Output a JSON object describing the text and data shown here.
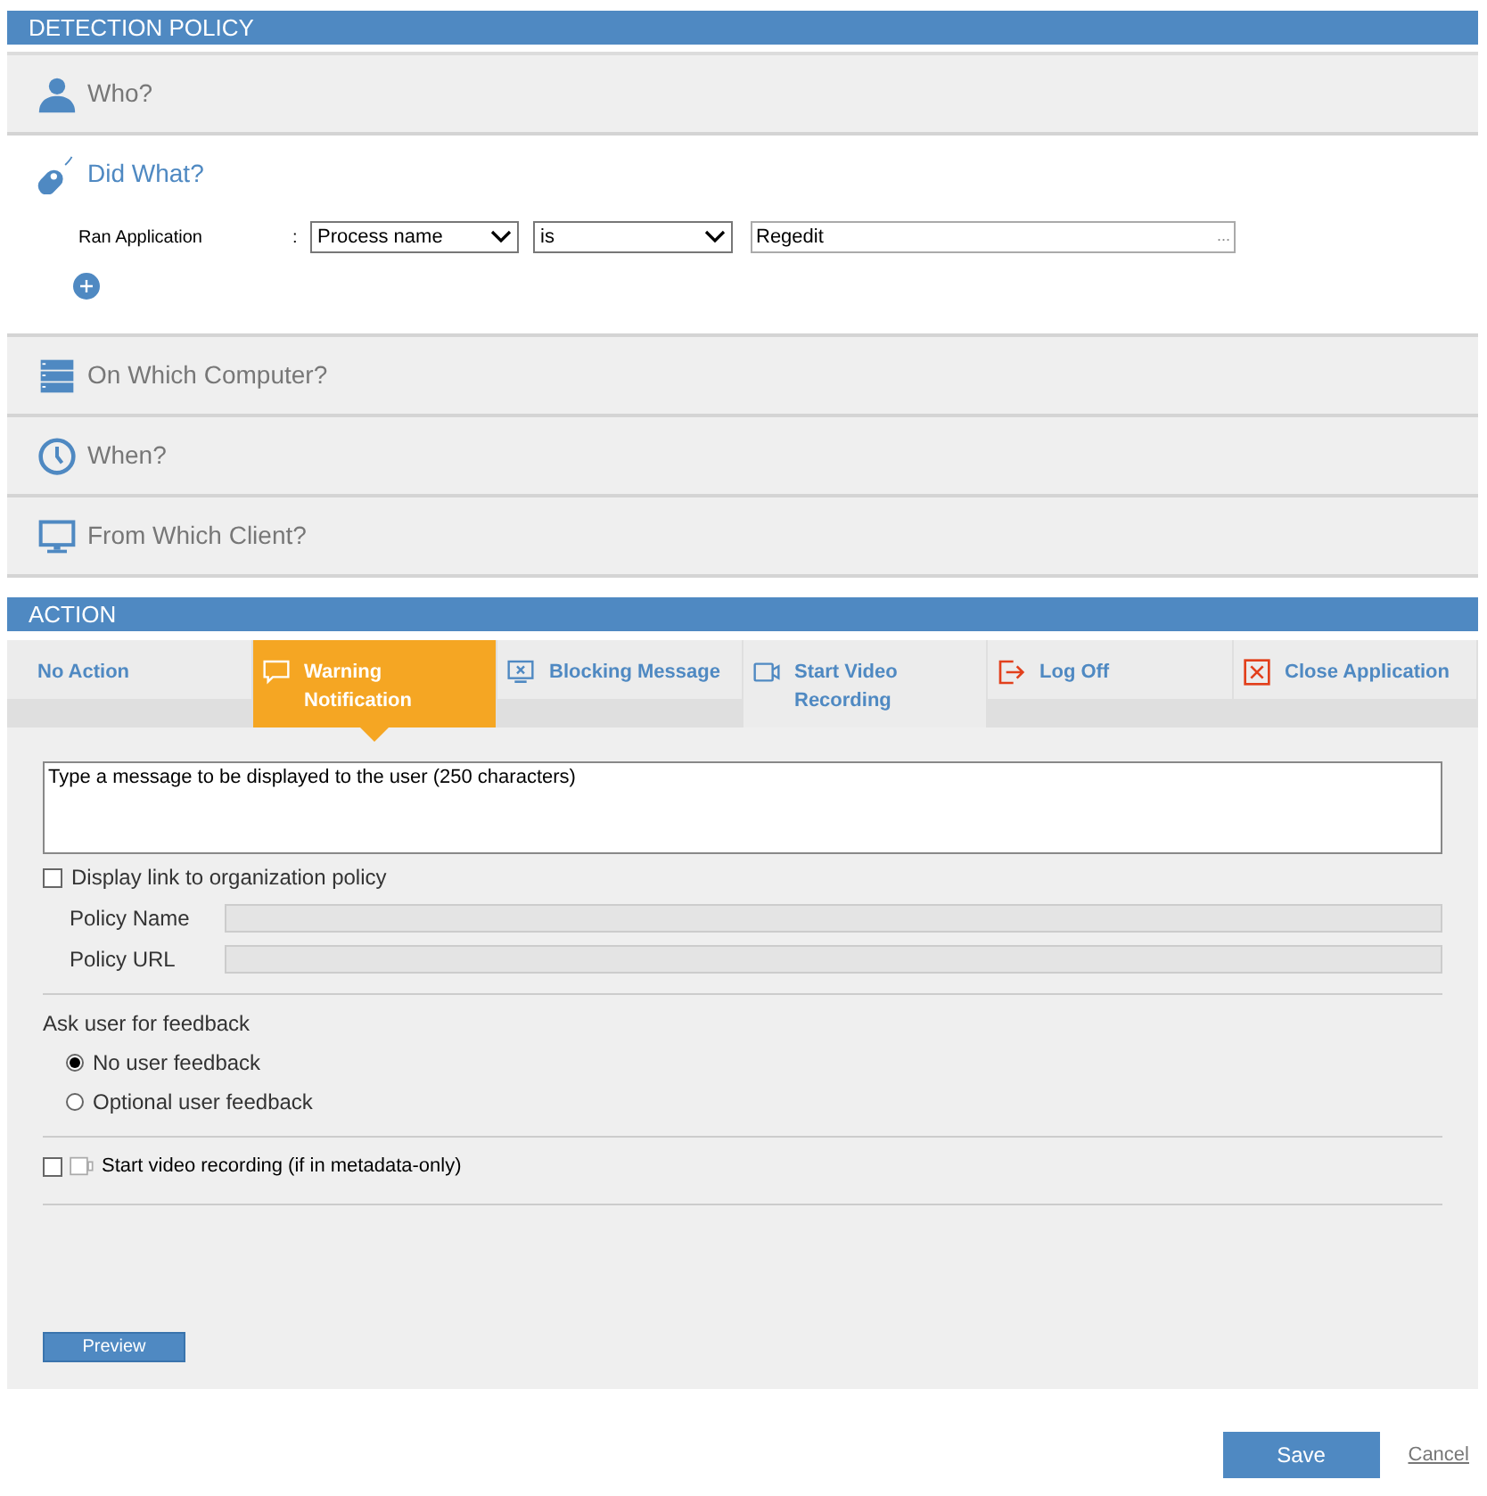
{
  "detection_policy": {
    "title": "DETECTION POLICY",
    "sections": [
      {
        "kind": "user",
        "label": "Who?",
        "expanded": false
      },
      {
        "kind": "mouse",
        "label": "Did What?",
        "expanded": true,
        "condition": {
          "label": "Ran Application",
          "separator": ":",
          "field": "Process name",
          "operator": "is",
          "value": "Regedit",
          "browse": "..."
        }
      },
      {
        "kind": "server",
        "label": "On Which Computer?",
        "expanded": false
      },
      {
        "kind": "clock",
        "label": "When?",
        "expanded": false
      },
      {
        "kind": "monitor",
        "label": "From Which Client?",
        "expanded": false
      }
    ]
  },
  "action": {
    "title": "ACTION",
    "tabs": [
      {
        "kind": "none",
        "label": "No Action",
        "selected": false
      },
      {
        "kind": "chat",
        "label": "Warning Notification",
        "selected": true
      },
      {
        "kind": "screen",
        "label": "Blocking Message",
        "selected": false
      },
      {
        "kind": "video",
        "label": "Start Video Recording",
        "selected": false
      },
      {
        "kind": "logoff",
        "label": "Log Off",
        "selected": false
      },
      {
        "kind": "close",
        "label": "Close Application",
        "selected": false
      }
    ],
    "message": {
      "placeholder": "Type a message to be displayed to the user (250 characters)"
    },
    "policy_link": {
      "label": "Display link to organization policy",
      "checked": false,
      "fields": [
        {
          "label": "Policy Name"
        },
        {
          "label": "Policy URL"
        }
      ]
    },
    "feedback": {
      "title": "Ask user for feedback",
      "options": [
        {
          "label": "No user feedback",
          "selected": true
        },
        {
          "label": "Optional user feedback",
          "selected": false
        }
      ]
    },
    "video_recording": {
      "label": "Start video recording (if in metadata-only)",
      "checked": false
    },
    "preview_button": "Preview"
  },
  "save_button": "Save",
  "cancel_link": "Cancel"
}
